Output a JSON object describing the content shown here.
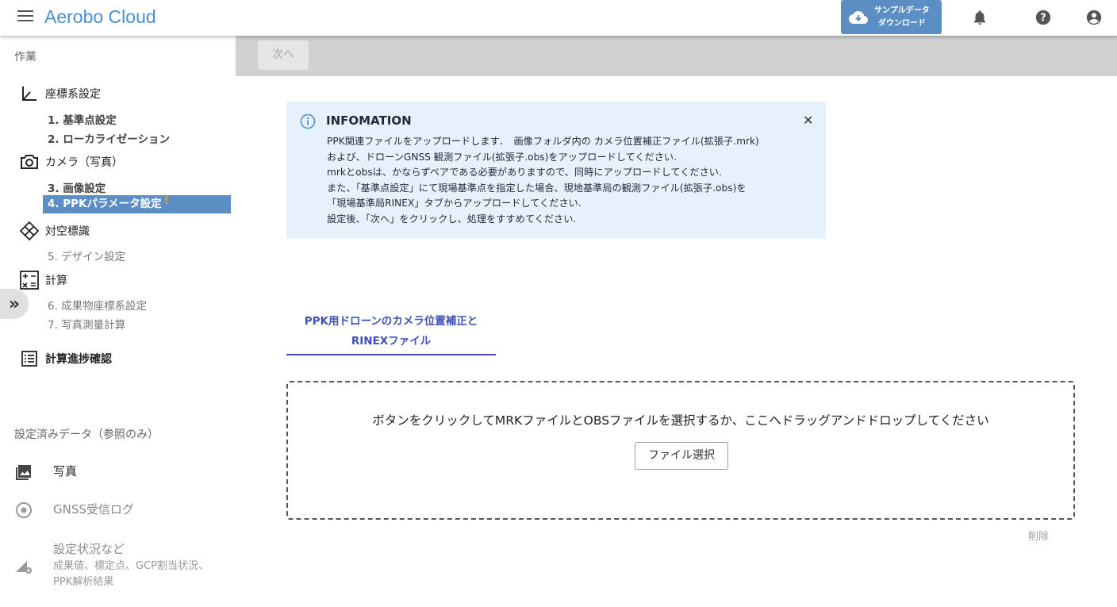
{
  "header": {
    "title": "Aerobo Cloud",
    "sample_download": [
      "サンプルデータ",
      "ダウンロード"
    ]
  },
  "sidebar": {
    "work_label": "作業",
    "groups": [
      {
        "label": "座標系設定",
        "icon": "axis-icon"
      },
      {
        "label": "カメラ（写真）",
        "icon": "camera-icon"
      },
      {
        "label": "対空標識",
        "icon": "marker-icon"
      },
      {
        "label": "計算",
        "icon": "calculator-icon"
      },
      {
        "label": "計算進捗確認",
        "icon": "list-icon"
      }
    ],
    "steps": [
      "1. 基準点設定",
      "2. ローカライゼーション",
      "3. 画像設定",
      "4. PPKパラメータ設定",
      "5. デザイン設定",
      "6. 成果物座標系設定",
      "7. 写真測量計算"
    ],
    "warning_mark": "!",
    "ref_label": "設定済みデータ（参照のみ）",
    "data_items": [
      {
        "label": "写真",
        "icon": "photo-icon"
      },
      {
        "label": "GNSS受信ログ",
        "icon": "gnss-icon"
      },
      {
        "label": "設定状況など",
        "icon": "settings-chart-icon",
        "desc": [
          "成果値、標定点、GCP割当状況、",
          "PPK解析結果"
        ]
      }
    ],
    "collapse": "»"
  },
  "toolbar": {
    "next_label": "次へ"
  },
  "info": {
    "title": "INFOMATION",
    "close": "✕",
    "lines": [
      "PPK関連ファイルをアップロードします．　画像フォルダ内の カメラ位置補正ファイル(拡張子.mrk)",
      "および、ドローンGNSS 観測ファイル(拡張子.obs)をアップロードしてください.",
      "mrkとobsは、かならずペアである必要がありますので、同時にアップロードしてください.",
      "また、「基準点設定」にて現場基準点を指定した場合、現地基準局の観測ファイル(拡張子.obs)を",
      "「現場基準局RINEX」タブからアップロードしてください.",
      "設定後、「次へ」をクリックし、処理をすすめてください."
    ]
  },
  "tab": {
    "line1": "PPK用ドローンのカメラ位置補正と",
    "line2": "RINEXファイル"
  },
  "dropzone": {
    "text": "ボタンをクリックしてMRKファイルとOBSファイルを選択するか、ここへドラッグアンドドロップしてください",
    "button": "ファイル選択"
  },
  "delete_label": "削除",
  "colors": {
    "brand": "#4a8fd0",
    "active": "#5b8ec4",
    "tab": "#3f51b5",
    "info_bg": "#e6f1fb",
    "warn": "#f0a020"
  }
}
